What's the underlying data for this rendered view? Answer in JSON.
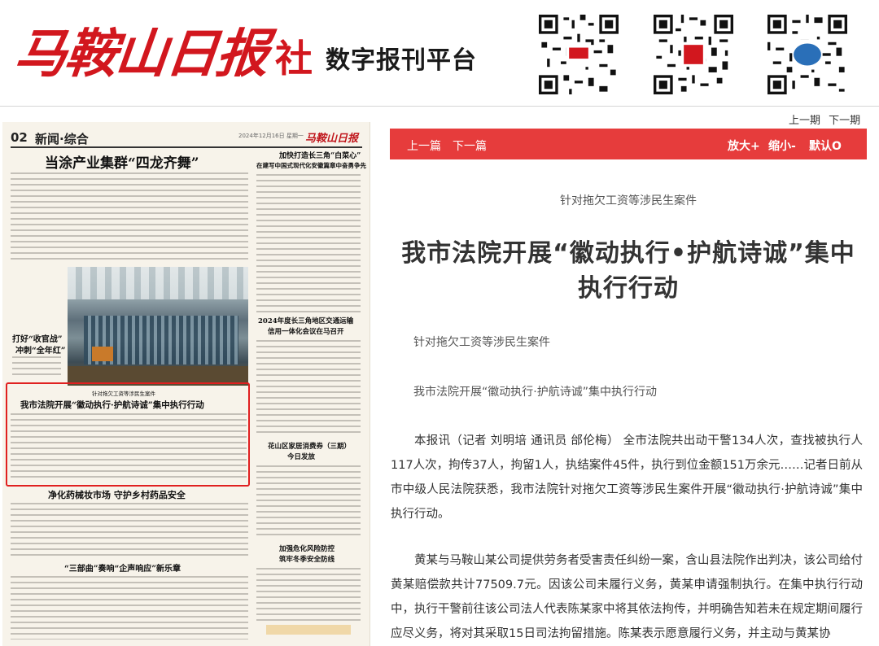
{
  "header": {
    "logo_text": "马鞍山日报",
    "logo_suffix": "社",
    "platform_name": "数字报刊平台",
    "qr_codes": [
      "qr-code-1",
      "qr-code-2",
      "qr-code-3"
    ]
  },
  "paper": {
    "page_number": "02",
    "section": "新闻·综合",
    "date_line": "2024年12月16日  星期一",
    "mini_logo": "马鞍山日报",
    "headlines": {
      "main": "当涂产业集群“四龙齐舞”",
      "right_top_1": "加快打造长三角“白菜心”",
      "right_top_2": "在建写中国式现代化安徽篇章中奋勇争先",
      "left_side_1": "打好“收官战”",
      "left_side_2": "冲刺“全年红”",
      "right_mid_1": "2024年度长三角地区交通运输",
      "right_mid_2": "信用一体化会议在马召开",
      "highlight_kicker": "针对拖欠工资等涉民生案件",
      "highlight": "我市法院开展“徽动执行·护航诗诚”集中执行行动",
      "right_lower_1": "花山区家居消费券（三期）",
      "right_lower_2": "今日发放",
      "bottom_1": "净化药械妆市场 守护乡村药品安全",
      "bottom_2": "“三部曲”奏响“企声响应”新乐章",
      "bottom_right_1": "加强危化风险防控",
      "bottom_right_2": "筑牢冬季安全防线"
    }
  },
  "nav": {
    "prev_issue": "上一期",
    "next_issue": "下一期"
  },
  "toolbar": {
    "prev_article": "上一篇",
    "next_article": "下一篇",
    "zoom_in": "放大+",
    "zoom_out": "缩小-",
    "default": "默认O",
    "color": "#e63c3c"
  },
  "article": {
    "pre_title": "针对拖欠工资等涉民生案件",
    "title": "我市法院开展“徽动执行•护航诗诚”集中执行行动",
    "subtitle_1": "针对拖欠工资等涉民生案件",
    "subtitle_2": "我市法院开展“徽动执行·护航诗诚”集中执行行动",
    "paragraph_1": "本报讯（记者 刘明培 通讯员 邰伦梅） 全市法院共出动干警134人次，查找被执行人117人次，拘传37人，拘留1人，执结案件45件，执行到位金额151万余元……记者日前从市中级人民法院获悉，我市法院针对拖欠工资等涉民生案件开展“徽动执行·护航诗诚”集中执行行动。",
    "paragraph_2": "黄某与马鞍山某公司提供劳务者受害责任纠纷一案，含山县法院作出判决，该公司给付黄某赔偿款共计77509.7元。因该公司未履行义务，黄某申请强制执行。在集中执行行动中，执行干警前往该公司法人代表陈某家中将其依法拘传，并明确告知若未在规定期间履行应尽义务，将对其采取15日司法拘留措施。陈某表示愿意履行义务，并主动与黄某协"
  }
}
